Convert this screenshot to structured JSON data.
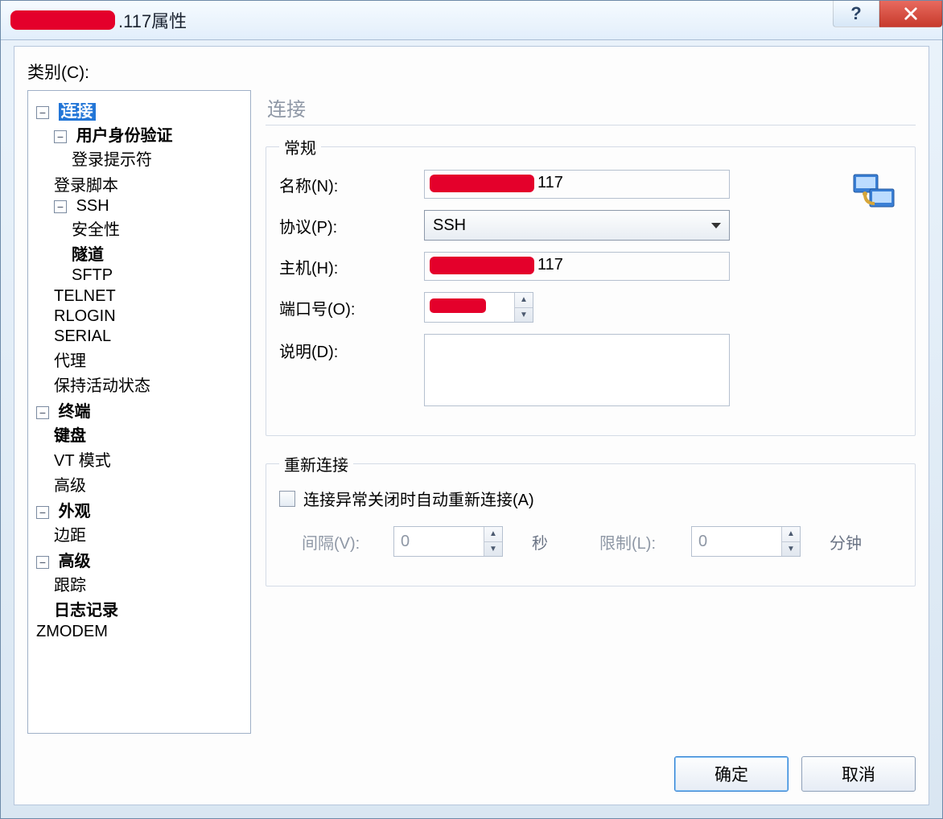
{
  "window": {
    "title_suffix": ".117属性"
  },
  "labels": {
    "category": "类别(C):",
    "section_title": "连接"
  },
  "tree": {
    "connection": "连接",
    "user_auth": "用户身份验证",
    "login_prompt": "登录提示符",
    "login_script": "登录脚本",
    "ssh": "SSH",
    "security": "安全性",
    "tunnel": "隧道",
    "sftp": "SFTP",
    "telnet": "TELNET",
    "rlogin": "RLOGIN",
    "serial": "SERIAL",
    "proxy": "代理",
    "keep_alive": "保持活动状态",
    "terminal": "终端",
    "keyboard": "键盘",
    "vt_mode": "VT 模式",
    "advanced_t": "高级",
    "appearance": "外观",
    "margin": "边距",
    "advanced": "高级",
    "trace": "跟踪",
    "logging": "日志记录",
    "zmodem": "ZMODEM"
  },
  "group_general": {
    "legend": "常规",
    "name_label": "名称(N):",
    "name_suffix": "117",
    "protocol_label": "协议(P):",
    "protocol_value": "SSH",
    "host_label": "主机(H):",
    "host_suffix": "117",
    "port_label": "端口号(O):",
    "desc_label": "说明(D):",
    "desc_value": ""
  },
  "group_reconnect": {
    "legend": "重新连接",
    "checkbox_label": "连接异常关闭时自动重新连接(A)",
    "interval_label": "间隔(V):",
    "interval_value": "0",
    "interval_unit": "秒",
    "limit_label": "限制(L):",
    "limit_value": "0",
    "limit_unit": "分钟"
  },
  "buttons": {
    "ok": "确定",
    "cancel": "取消"
  }
}
